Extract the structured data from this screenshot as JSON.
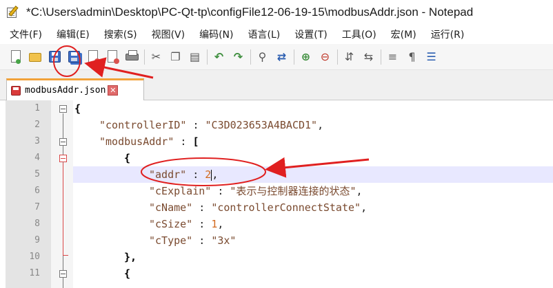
{
  "window": {
    "title": "*C:\\Users\\admin\\Desktop\\PC-Qt-tp\\configFile12-06-19-15\\modbusAddr.json - Notepad"
  },
  "menu": {
    "items": [
      {
        "label": "文件(F)"
      },
      {
        "label": "编辑(E)"
      },
      {
        "label": "搜索(S)"
      },
      {
        "label": "视图(V)"
      },
      {
        "label": "编码(N)"
      },
      {
        "label": "语言(L)"
      },
      {
        "label": "设置(T)"
      },
      {
        "label": "工具(O)"
      },
      {
        "label": "宏(M)"
      },
      {
        "label": "运行(R)"
      }
    ]
  },
  "toolbar": {
    "icons": [
      "new-file-icon",
      "open-file-icon",
      "save-icon",
      "save-all-icon",
      "close-file-icon",
      "close-all-icon",
      "print-icon",
      "cut-icon",
      "copy-icon",
      "paste-icon",
      "undo-icon",
      "redo-icon",
      "find-icon",
      "replace-icon",
      "zoom-in-icon",
      "zoom-out-icon",
      "sync-vertical-icon",
      "sync-horizontal-icon",
      "word-wrap-icon",
      "show-all-chars-icon",
      "indent-guide-icon"
    ]
  },
  "tab": {
    "label": "modbusAddr.json"
  },
  "editor": {
    "current_line": 5,
    "lines": [
      {
        "num": "1"
      },
      {
        "num": "2"
      },
      {
        "num": "3"
      },
      {
        "num": "4"
      },
      {
        "num": "5"
      },
      {
        "num": "6"
      },
      {
        "num": "7"
      },
      {
        "num": "8"
      },
      {
        "num": "9"
      },
      {
        "num": "10"
      },
      {
        "num": "11"
      }
    ],
    "code": {
      "l1": "{",
      "l2_key": "\"controllerID\"",
      "l2_val": "\"C3D023653A4BACD1\"",
      "l3_key": "\"modbusAddr\"",
      "l3_bracket": "[",
      "l4": "{",
      "l5_key": "\"addr\"",
      "l5_val": "2",
      "l6_key": "\"cExplain\"",
      "l6_val": "\"表示与控制器连接的状态\"",
      "l7_key": "\"cName\"",
      "l7_val": "\"controllerConnectState\"",
      "l8_key": "\"cSize\"",
      "l8_val": "1",
      "l9_key": "\"cType\"",
      "l9_val": "\"3x\"",
      "l10": "},",
      "l11": "{"
    }
  },
  "colors": {
    "annotation": "#e02020",
    "current_line_bg": "#e8e8ff",
    "tab_accent": "#f2a23a"
  }
}
